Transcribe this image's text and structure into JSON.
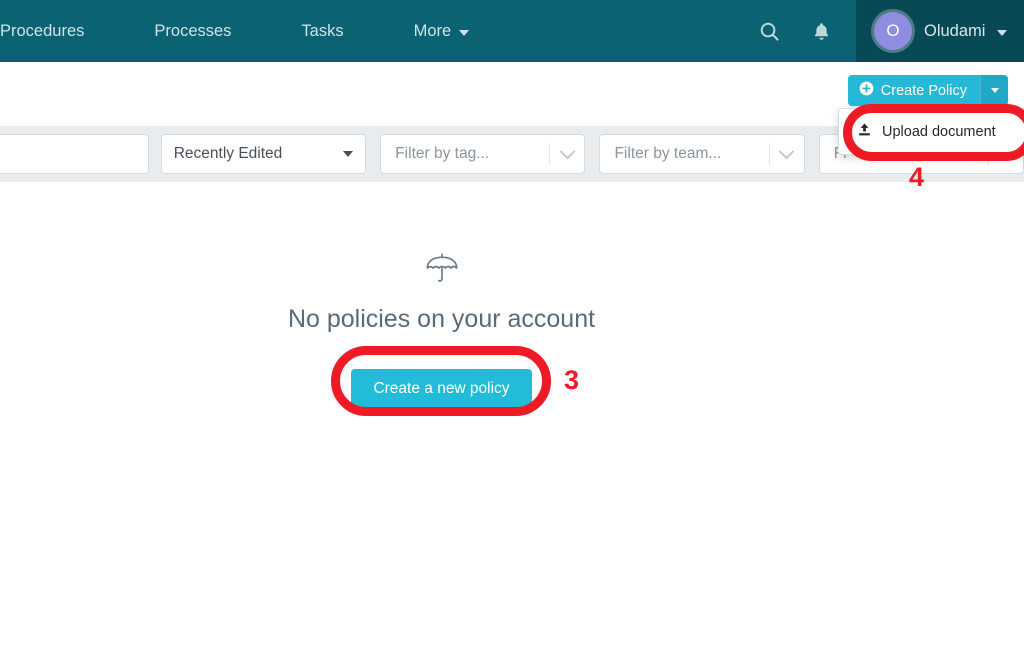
{
  "topbar": {
    "nav_items": [
      {
        "label": "Procedures",
        "icon": ""
      },
      {
        "label": "Processes",
        "icon": ""
      },
      {
        "label": "Tasks",
        "icon": ""
      },
      {
        "label": "More",
        "icon": "chevron-down-icon"
      }
    ],
    "search_icon": "search-icon",
    "notifications_icon": "bell-icon",
    "user": {
      "initial": "O",
      "name": "Oludami",
      "caret_icon": "chevron-down-icon"
    }
  },
  "action_row": {
    "create_policy_label": "Create Policy",
    "create_policy_icon": "plus-circle-icon",
    "dropdown_toggle_icon": "caret-down-icon"
  },
  "dropdown": {
    "items": [
      {
        "label": "Upload document",
        "icon": "upload-icon"
      }
    ]
  },
  "filters": {
    "search_value": "",
    "search_placeholder": "",
    "sort_value": "Recently Edited",
    "tag_placeholder": "Filter by tag...",
    "team_placeholder": "Filter by team...",
    "third_placeholder": "Fi"
  },
  "empty_state": {
    "icon": "umbrella-icon",
    "title": "No policies on your account",
    "cta_label": "Create a new policy"
  },
  "annotations": [
    {
      "number": "3",
      "target": "create-a-new-policy-button"
    },
    {
      "number": "4",
      "target": "upload-document-menu-item"
    }
  ],
  "colors": {
    "header_teal": "#0a6273",
    "header_teal_dark": "#074a55",
    "accent_cyan": "#22bcd8",
    "annotation_red": "#ee1b24",
    "avatar_purple": "#8f8de0",
    "filterbar_gray": "#e9ecef"
  }
}
